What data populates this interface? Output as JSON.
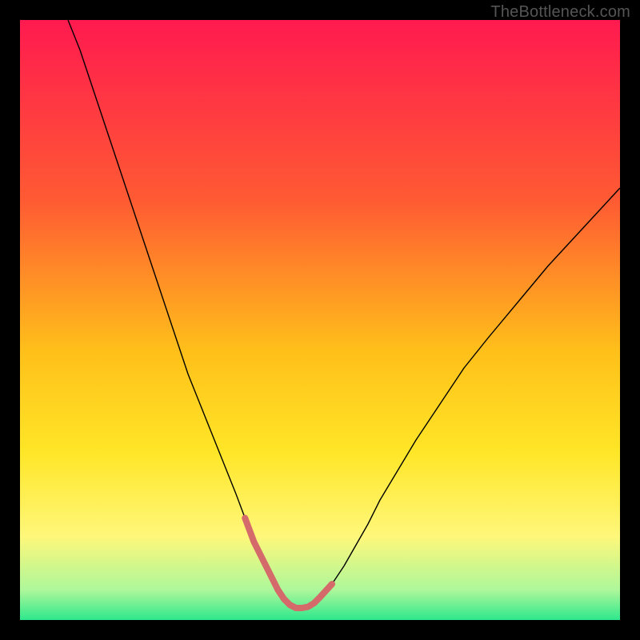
{
  "watermark": "TheBottleneck.com",
  "chart_data": {
    "type": "line",
    "title": "",
    "xlabel": "",
    "ylabel": "",
    "xlim": [
      0,
      100
    ],
    "ylim": [
      0,
      100
    ],
    "grid": false,
    "background_gradient": {
      "stops": [
        {
          "offset": 0.0,
          "color": "#ff1a4f"
        },
        {
          "offset": 0.3,
          "color": "#ff5a33"
        },
        {
          "offset": 0.55,
          "color": "#ffbf1a"
        },
        {
          "offset": 0.72,
          "color": "#ffe627"
        },
        {
          "offset": 0.86,
          "color": "#fff77a"
        },
        {
          "offset": 0.95,
          "color": "#adf79a"
        },
        {
          "offset": 1.0,
          "color": "#2ee88c"
        }
      ]
    },
    "series": [
      {
        "name": "bottleneck-curve",
        "color": "#000000",
        "width": 1.4,
        "x": [
          8,
          10,
          12,
          14,
          16,
          18,
          20,
          22,
          24,
          26,
          28,
          30,
          32,
          34,
          36,
          37.5,
          39,
          40.5,
          42,
          43,
          44,
          45,
          46,
          47,
          48,
          49,
          50,
          52,
          54,
          56,
          58,
          60,
          63,
          66,
          70,
          74,
          78,
          83,
          88,
          94,
          100
        ],
        "y": [
          100,
          95,
          89,
          83,
          77,
          71,
          65,
          59,
          53,
          47,
          41,
          36,
          31,
          26,
          21,
          17,
          13,
          10,
          7,
          5,
          3.5,
          2.5,
          2,
          2,
          2.2,
          2.8,
          3.8,
          6,
          9,
          12.5,
          16,
          20,
          25,
          30,
          36,
          42,
          47,
          53,
          59,
          65.5,
          72
        ]
      },
      {
        "name": "highlight-range",
        "color": "#d46a6a",
        "width": 8,
        "linecap": "round",
        "x": [
          37.5,
          39,
          40.5,
          42,
          43,
          44,
          45,
          46,
          47,
          48,
          49,
          50,
          52
        ],
        "y": [
          17,
          13,
          10,
          7,
          5,
          3.5,
          2.5,
          2,
          2,
          2.2,
          2.8,
          3.8,
          6
        ]
      }
    ]
  }
}
